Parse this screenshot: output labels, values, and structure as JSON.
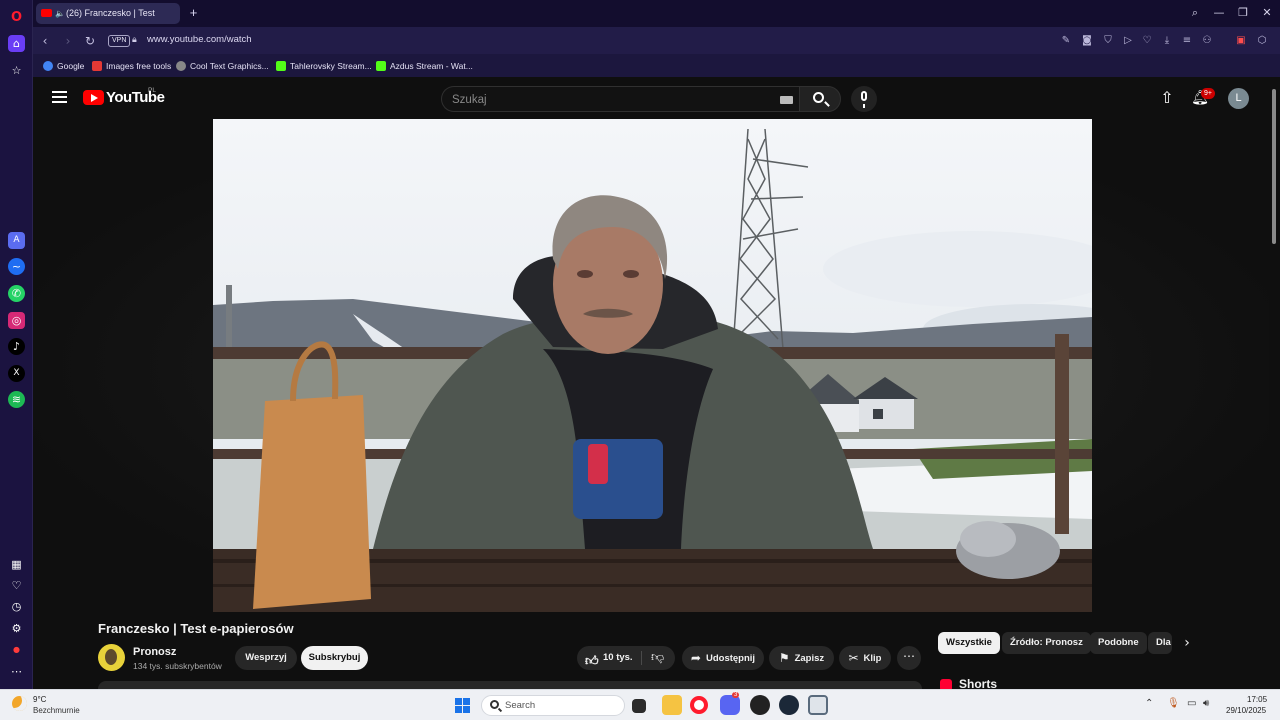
{
  "browser": {
    "tab": {
      "title": "(26) Franczesko | Test"
    },
    "address": {
      "vpn_badge": "VPN",
      "url": "www.youtube.com/watch"
    },
    "bookmarks": [
      {
        "label": "Google",
        "color": "#4285f4"
      },
      {
        "label": "Images free tools",
        "color": "#e53935"
      },
      {
        "label": "Cool Text Graphics...",
        "color": "#888888"
      },
      {
        "label": "Tahlerovsky Stream...",
        "color": "#53fc18"
      },
      {
        "label": "Azdus Stream - Wat...",
        "color": "#53fc18"
      }
    ],
    "sidebar_icons": [
      "opera-logo",
      "home",
      "star",
      "aria",
      "messenger",
      "whatsapp",
      "instagram",
      "tiktok",
      "x",
      "spotify",
      "workspaces",
      "heart",
      "history",
      "settings",
      "extensions",
      "more"
    ]
  },
  "youtube": {
    "logo_text": "YouTube",
    "country_code": "PL",
    "search_placeholder": "Szukaj",
    "notifications_badge": "9+",
    "avatar_letter": "L"
  },
  "video": {
    "title": "Franczesko | Test e-papierosów",
    "channel": "Pronosz",
    "subscribers": "134 tys. subskrybentów",
    "join_label": "Wesprzyj",
    "subscribe_label": "Subskrybuj",
    "likes": "10 tys.",
    "share_label": "Udostępnij",
    "save_label": "Zapisz",
    "clip_label": "Klip",
    "more_label": "⋯"
  },
  "related": {
    "chips": [
      "Wszystkie",
      "Źródło: Pronosz",
      "Podobne",
      "Dla"
    ],
    "section_title": "Shorts"
  },
  "taskbar": {
    "weather_temp": "9°C",
    "weather_desc": "Bezchmurnie",
    "search_label": "Search",
    "time": "17:05",
    "date": "29/10/2025",
    "discord_badge": "3"
  }
}
